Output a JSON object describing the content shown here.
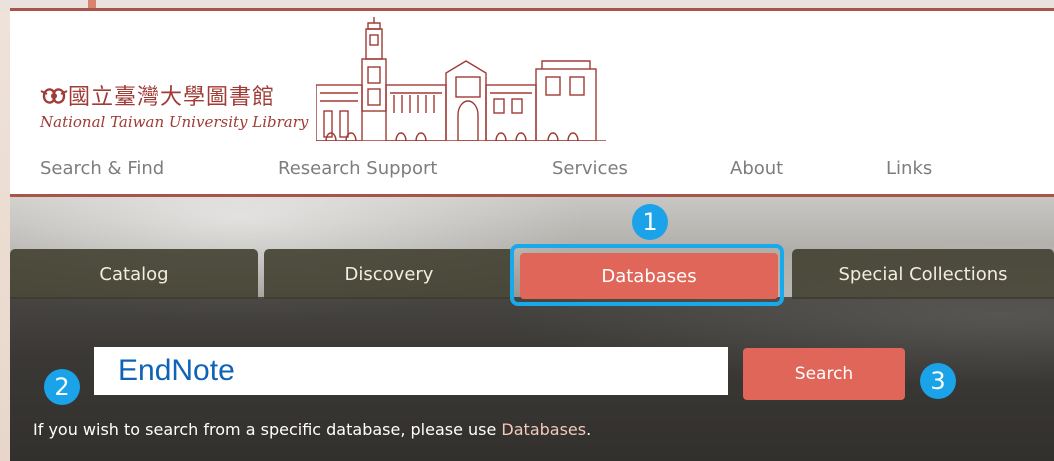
{
  "library": {
    "name_cn": "國立臺灣大學圖書館",
    "name_en": "National Taiwan University Library"
  },
  "nav": {
    "items": [
      "Search & Find",
      "Research Support",
      "Services",
      "About",
      "Links"
    ]
  },
  "tabs": [
    {
      "label": "Catalog",
      "active": false
    },
    {
      "label": "Discovery",
      "active": false
    },
    {
      "label": "Databases",
      "active": true
    },
    {
      "label": "Special Collections",
      "active": false
    }
  ],
  "search": {
    "value": "EndNote",
    "button_label": "Search"
  },
  "hint": {
    "text": "If you wish to search from a specific database, please use ",
    "link": "Databases",
    "suffix": "."
  },
  "annotations": {
    "step1": "1",
    "step2": "2",
    "step3": "3"
  },
  "colors": {
    "brand": "#a03b36",
    "accent": "#e0665a",
    "highlight": "#19a9ea",
    "input_text": "#0e63b6"
  }
}
